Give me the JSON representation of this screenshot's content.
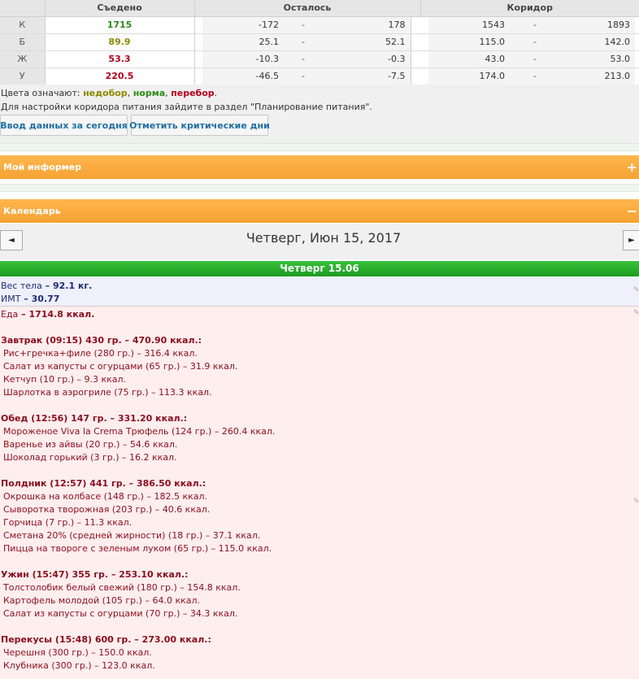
{
  "table": {
    "headers": {
      "eaten": "Съедено",
      "remaining": "Осталось",
      "corridor": "Коридор"
    },
    "dash": "-",
    "rows": [
      {
        "label": "К",
        "eaten": "1715",
        "eaten_color": "#2e8b1a",
        "rem_min": "-172",
        "rem_max": "178",
        "cor_min": "1543",
        "cor_max": "1893"
      },
      {
        "label": "Б",
        "eaten": "89.9",
        "eaten_color": "#8f8a00",
        "rem_min": "25.1",
        "rem_max": "52.1",
        "cor_min": "115.0",
        "cor_max": "142.0"
      },
      {
        "label": "Ж",
        "eaten": "53.3",
        "eaten_color": "#b3001b",
        "rem_min": "-10.3",
        "rem_max": "-0.3",
        "cor_min": "43.0",
        "cor_max": "53.0"
      },
      {
        "label": "У",
        "eaten": "220.5",
        "eaten_color": "#b3001b",
        "rem_min": "-46.5",
        "rem_max": "-7.5",
        "cor_min": "174.0",
        "cor_max": "213.0"
      }
    ]
  },
  "legend": {
    "prefix": "Цвета означают: ",
    "under": "недобор",
    "sep1": ", ",
    "normal": "норма",
    "sep2": ", ",
    "over": "перебор",
    "end": ".",
    "colors": {
      "under": "#8f8a00",
      "normal": "#2e8b1a",
      "over": "#b3001b"
    }
  },
  "note": "Для настройки коридора питания зайдите в раздел \"Планирование питания\".",
  "buttons": {
    "enter_today": "Ввод данных за сегодня",
    "mark_critical": "Отметить критические дни"
  },
  "panels": {
    "informer": {
      "title": "Мой информер",
      "toggle": "+"
    },
    "calendar": {
      "title": "Календарь",
      "toggle": "−"
    }
  },
  "calendar": {
    "prev": "◄",
    "next": "►",
    "date_title": "Четверг, Июн 15, 2017",
    "day_label": "Четверг 15.06"
  },
  "metrics": {
    "weight_label": "Вес тела",
    "weight_value": " – 92.1 кг.",
    "bmi_label": "ИМТ",
    "bmi_value": " – 30.77"
  },
  "food": {
    "total_label": "Еда",
    "total_value": " – 1714.8 ккал.",
    "meals": [
      {
        "heading": "Завтрак (09:15) 430 гр. – 470.90 ккал.:",
        "items": [
          "Рис+гречка+филе (280 гр.) – 316.4 ккал.",
          "Салат из капусты с огурцами (65 гр.) – 31.9 ккал.",
          "Кетчуп (10 гр.) – 9.3 ккал.",
          "Шарлотка в аэрогриле (75 гр.) – 113.3 ккал."
        ]
      },
      {
        "heading": "Обед (12:56) 147 гр. – 331.20 ккал.:",
        "items": [
          "Мороженое Viva la Crema Трюфель (124 гр.) – 260.4 ккал.",
          "Варенье из айвы (20 гр.) – 54.6 ккал.",
          "Шоколад горький (3 гр.) – 16.2 ккал."
        ]
      },
      {
        "heading": "Полдник (12:57) 441 гр. – 386.50 ккал.:",
        "items": [
          "Окрошка на колбасе (148 гр.) – 182.5 ккал.",
          "Сыворотка творожная (203 гр.) – 40.6 ккал.",
          "Горчица (7 гр.) – 11.3 ккал.",
          "Сметана 20% (средней жирности) (18 гр.) – 37.1 ккал.",
          "Пицца на твороге с зеленым луком (65 гр.) – 115.0 ккал."
        ]
      },
      {
        "heading": "Ужин (15:47) 355 гр. – 253.10 ккал.:",
        "items": [
          "Толстолобик белый свежий (180 гр.) – 154.8 ккал.",
          "Картофель молодой (105 гр.) – 64.0 ккал.",
          "Салат из капусты с огурцами (70 гр.) – 34.3 ккал."
        ]
      },
      {
        "heading": "Перекусы (15:48) 600 гр. – 273.00 ккал.:",
        "items": [
          "Черешня (300 гр.) – 150.0 ккал.",
          "Клубника (300 гр.) – 123.0 ккал."
        ]
      }
    ]
  },
  "icons": {
    "edit": "edit-icon"
  }
}
